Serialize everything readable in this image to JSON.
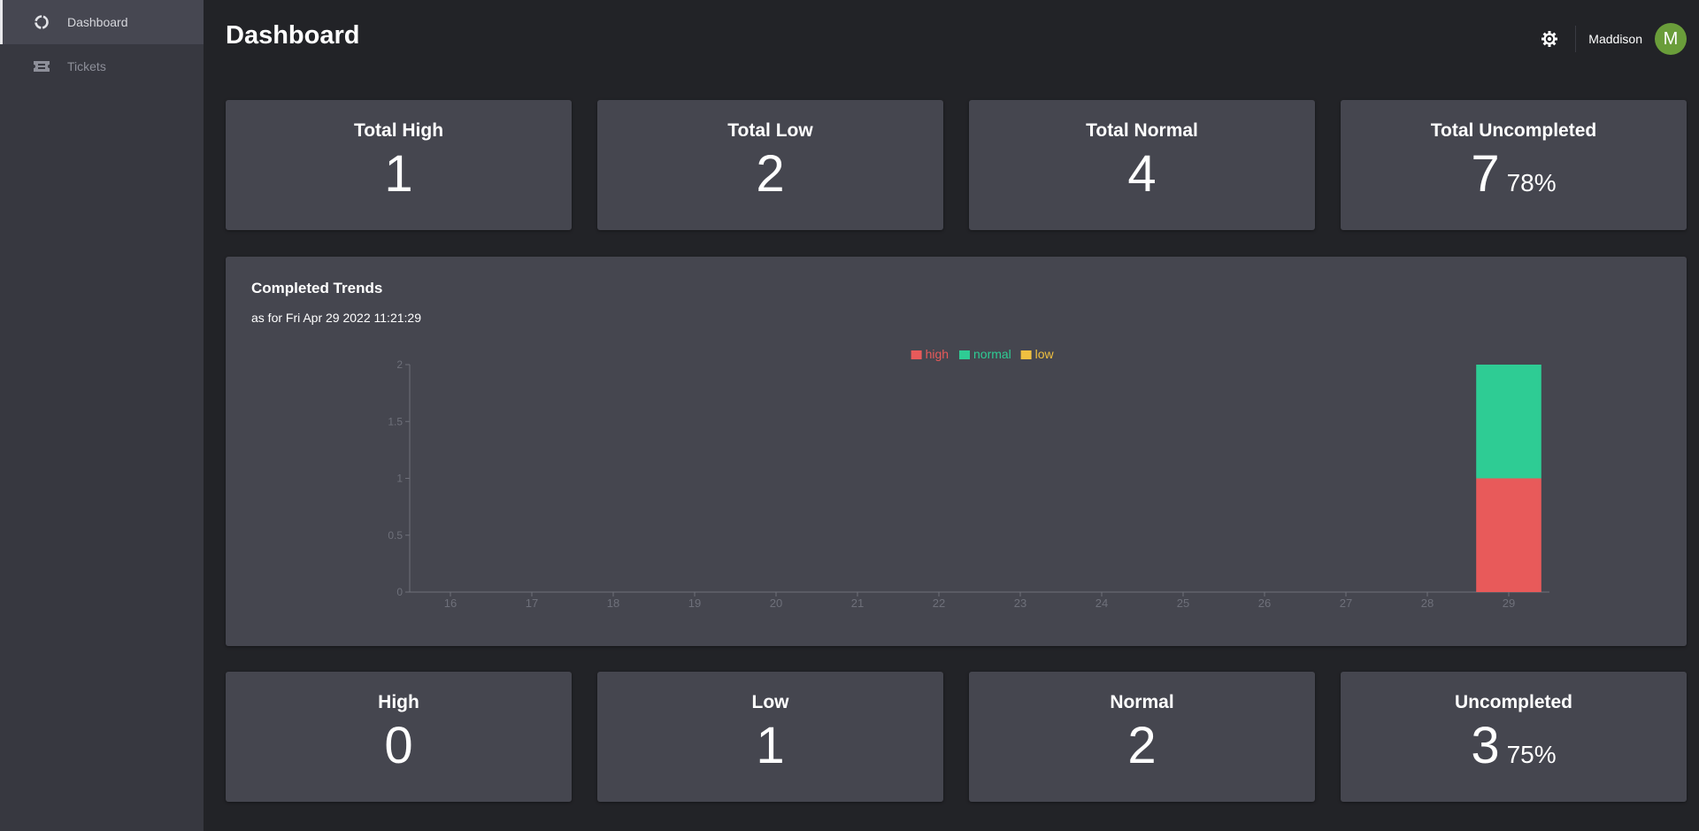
{
  "sidebar": {
    "items": [
      {
        "label": "Dashboard",
        "icon": "dashboard-icon",
        "active": true
      },
      {
        "label": "Tickets",
        "icon": "ticket-icon",
        "active": false
      }
    ]
  },
  "header": {
    "title": "Dashboard",
    "username": "Maddison",
    "avatar_initial": "M",
    "avatar_color": "#6a9d3a"
  },
  "stats_total": [
    {
      "title": "Total High",
      "value": "1",
      "pct": ""
    },
    {
      "title": "Total Low",
      "value": "2",
      "pct": ""
    },
    {
      "title": "Total Normal",
      "value": "4",
      "pct": ""
    },
    {
      "title": "Total Uncompleted",
      "value": "7",
      "pct": "78%"
    }
  ],
  "stats_recent": [
    {
      "title": "High",
      "value": "0",
      "pct": ""
    },
    {
      "title": "Low",
      "value": "1",
      "pct": ""
    },
    {
      "title": "Normal",
      "value": "2",
      "pct": ""
    },
    {
      "title": "Uncompleted",
      "value": "3",
      "pct": "75%"
    }
  ],
  "trend": {
    "title": "Completed Trends",
    "subtitle": "as for Fri Apr 29 2022 11:21:29"
  },
  "chart_data": {
    "type": "bar",
    "stacked": true,
    "categories": [
      "16",
      "17",
      "18",
      "19",
      "20",
      "21",
      "22",
      "23",
      "24",
      "25",
      "26",
      "27",
      "28",
      "29"
    ],
    "series": [
      {
        "name": "high",
        "color": "#e85a5a",
        "values": [
          0,
          0,
          0,
          0,
          0,
          0,
          0,
          0,
          0,
          0,
          0,
          0,
          0,
          1
        ]
      },
      {
        "name": "normal",
        "color": "#2ecc94",
        "values": [
          0,
          0,
          0,
          0,
          0,
          0,
          0,
          0,
          0,
          0,
          0,
          0,
          0,
          1
        ]
      },
      {
        "name": "low",
        "color": "#f0c040",
        "values": [
          0,
          0,
          0,
          0,
          0,
          0,
          0,
          0,
          0,
          0,
          0,
          0,
          0,
          0
        ]
      }
    ],
    "ylim": [
      0,
      2
    ],
    "yticks": [
      "0",
      "0.5",
      "1",
      "1.5",
      "2"
    ],
    "legend_position": "top-center",
    "grid": false
  }
}
